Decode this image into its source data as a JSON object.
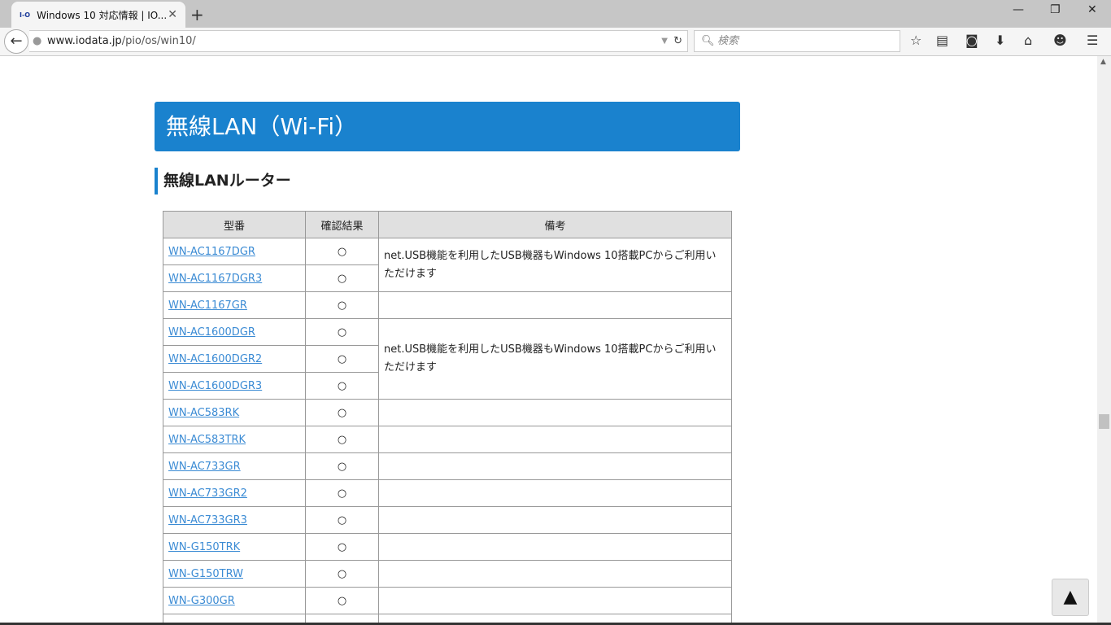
{
  "browser": {
    "tab_title": "Windows 10 対応情報 | IO...",
    "favicon": "I-O",
    "url_domain": "www.iodata.jp",
    "url_path": "/pio/os/win10/",
    "search_placeholder": "検索"
  },
  "page": {
    "section_title": "無線LAN（Wi-Fi）",
    "subsection_title": "無線LANルーター",
    "table": {
      "headers": [
        "型番",
        "確認結果",
        "備考"
      ],
      "note": "net.USB機能を利用したUSB機器もWindows 10搭載PCからご利用いただけます",
      "rows": [
        {
          "model": "WN-AC1167DGR",
          "result": "○"
        },
        {
          "model": "WN-AC1167DGR3",
          "result": "○"
        },
        {
          "model": "WN-AC1167GR",
          "result": "○"
        },
        {
          "model": "WN-AC1600DGR",
          "result": "○"
        },
        {
          "model": "WN-AC1600DGR2",
          "result": "○"
        },
        {
          "model": "WN-AC1600DGR3",
          "result": "○"
        },
        {
          "model": "WN-AC583RK",
          "result": "○"
        },
        {
          "model": "WN-AC583TRK",
          "result": "○"
        },
        {
          "model": "WN-AC733GR",
          "result": "○"
        },
        {
          "model": "WN-AC733GR2",
          "result": "○"
        },
        {
          "model": "WN-AC733GR3",
          "result": "○"
        },
        {
          "model": "WN-G150TRK",
          "result": "○"
        },
        {
          "model": "WN-G150TRW",
          "result": "○"
        },
        {
          "model": "WN-G300GR",
          "result": "○"
        }
      ]
    },
    "back_to_top": "▲"
  }
}
